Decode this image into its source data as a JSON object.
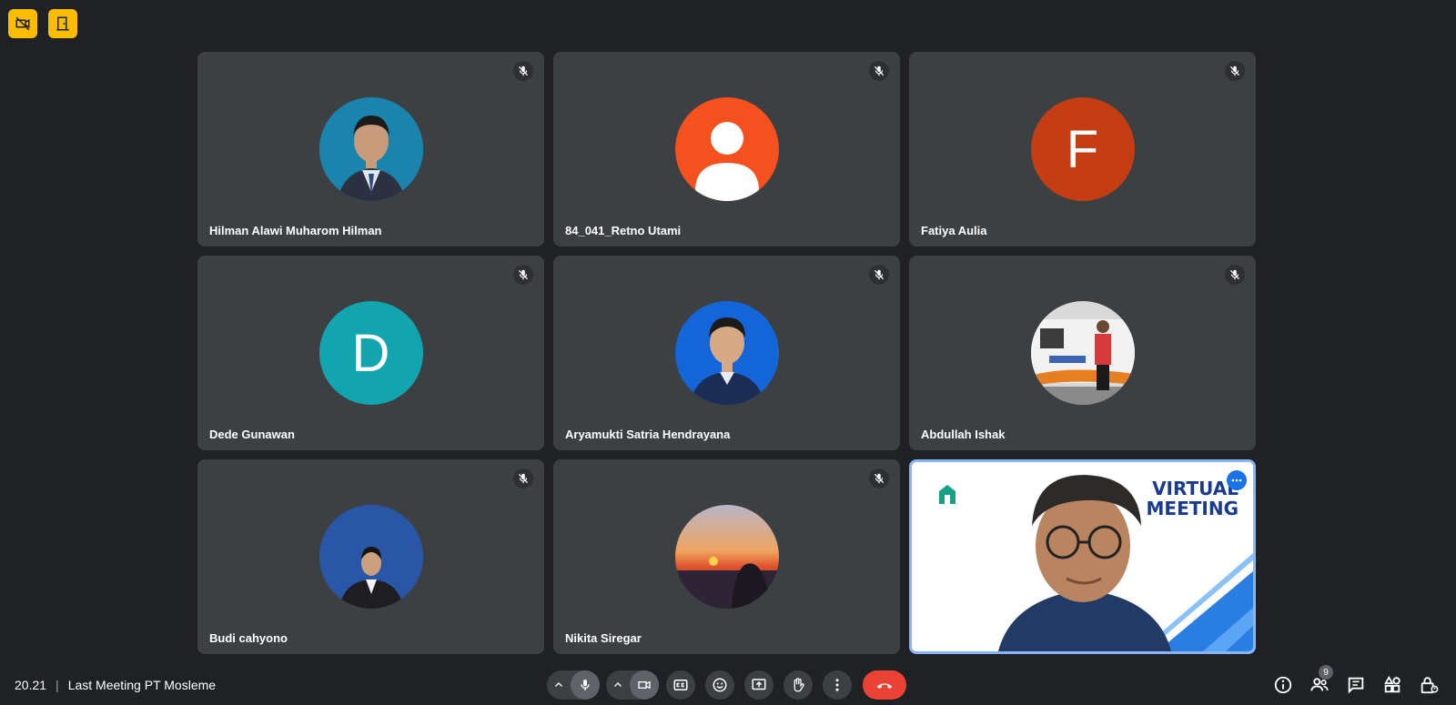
{
  "participants": [
    {
      "name": "Hilman Alawi Muharom Hilman",
      "avatar": "photo-man-suit-blue-background",
      "muted": true
    },
    {
      "name": "84_041_Retno Utami",
      "avatar": "default-person-icon",
      "color": "#f4511e",
      "muted": true
    },
    {
      "name": "Fatiya Aulia",
      "avatar_letter": "F",
      "color": "#c53d13",
      "muted": true
    },
    {
      "name": "Dede Gunawan",
      "avatar_letter": "D",
      "color": "#12a4af",
      "muted": true
    },
    {
      "name": "Aryamukti Satria Hendrayana",
      "avatar": "photo-man-blue-shirt",
      "muted": true
    },
    {
      "name": "Abdullah Ishak",
      "avatar": "photo-man-by-train",
      "muted": true
    },
    {
      "name": "Budi cahyono",
      "avatar": "photo-man-suit-blue-background",
      "muted": true
    },
    {
      "name": "Nikita Siregar",
      "avatar": "photo-sunset-silhouette",
      "muted": true
    }
  ],
  "self_tile": {
    "banner_line1": "VIRTUAL",
    "banner_line2": "MEETING",
    "logo": "mosleme-logo",
    "more_icon": "more-horizontal-icon"
  },
  "meeting": {
    "time": "20.21",
    "separator": "|",
    "title": "Last Meeting PT Mosleme"
  },
  "controls": {
    "participant_count": "9"
  },
  "colors": {
    "background": "#202124",
    "tile": "#3c4043",
    "accent": "#8ab4f8",
    "badge": "#fbbc04",
    "end_call": "#ea4335"
  }
}
